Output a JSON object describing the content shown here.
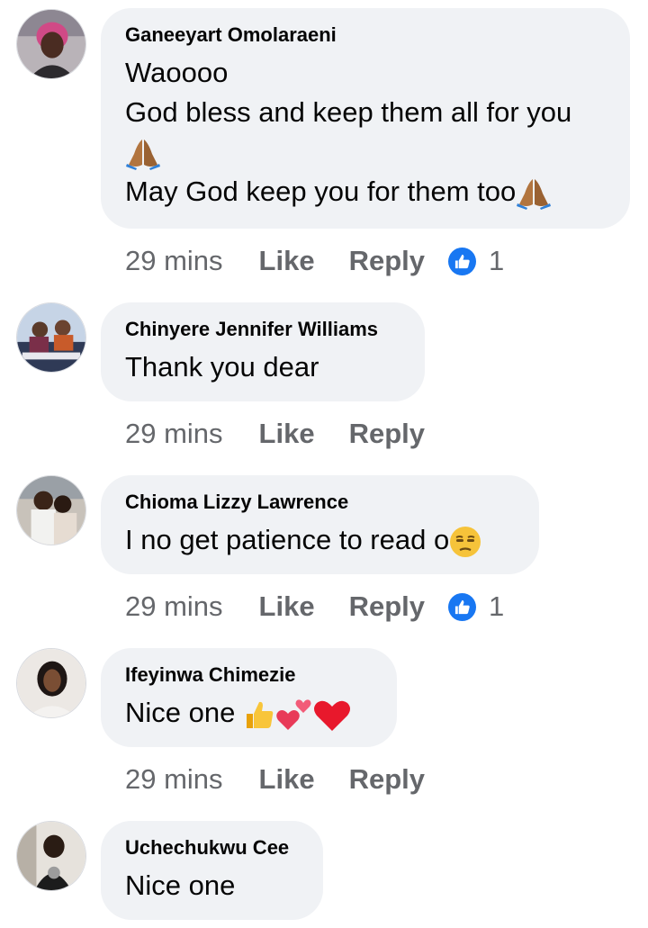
{
  "comments": [
    {
      "author": "Ganeeyart Omolaraeni",
      "lines": [
        "Waoooo",
        "God bless and keep them all for you",
        "May God keep you for them too"
      ],
      "time": "29 mins",
      "like_label": "Like",
      "reply_label": "Reply",
      "reaction_count": "1",
      "emoji": [
        "folded-hands",
        "folded-hands"
      ]
    },
    {
      "author": "Chinyere Jennifer Williams",
      "lines": [
        "Thank you dear"
      ],
      "time": "29 mins",
      "like_label": "Like",
      "reply_label": "Reply"
    },
    {
      "author": "Chioma Lizzy Lawrence",
      "lines": [
        "I no get patience to read o"
      ],
      "time": "29 mins",
      "like_label": "Like",
      "reply_label": "Reply",
      "reaction_count": "1",
      "emoji": [
        "unamused-face"
      ]
    },
    {
      "author": "Ifeyinwa Chimezie",
      "lines": [
        "Nice one"
      ],
      "time": "29 mins",
      "like_label": "Like",
      "reply_label": "Reply",
      "emoji": [
        "thumbs-up",
        "two-hearts",
        "red-heart"
      ]
    },
    {
      "author": "Uchechukwu Cee",
      "lines": [
        "Nice one"
      ]
    }
  ],
  "colors": {
    "bubble": "#f0f2f5",
    "text": "#050505",
    "meta": "#65676b",
    "like_badge": "#1877f2"
  }
}
